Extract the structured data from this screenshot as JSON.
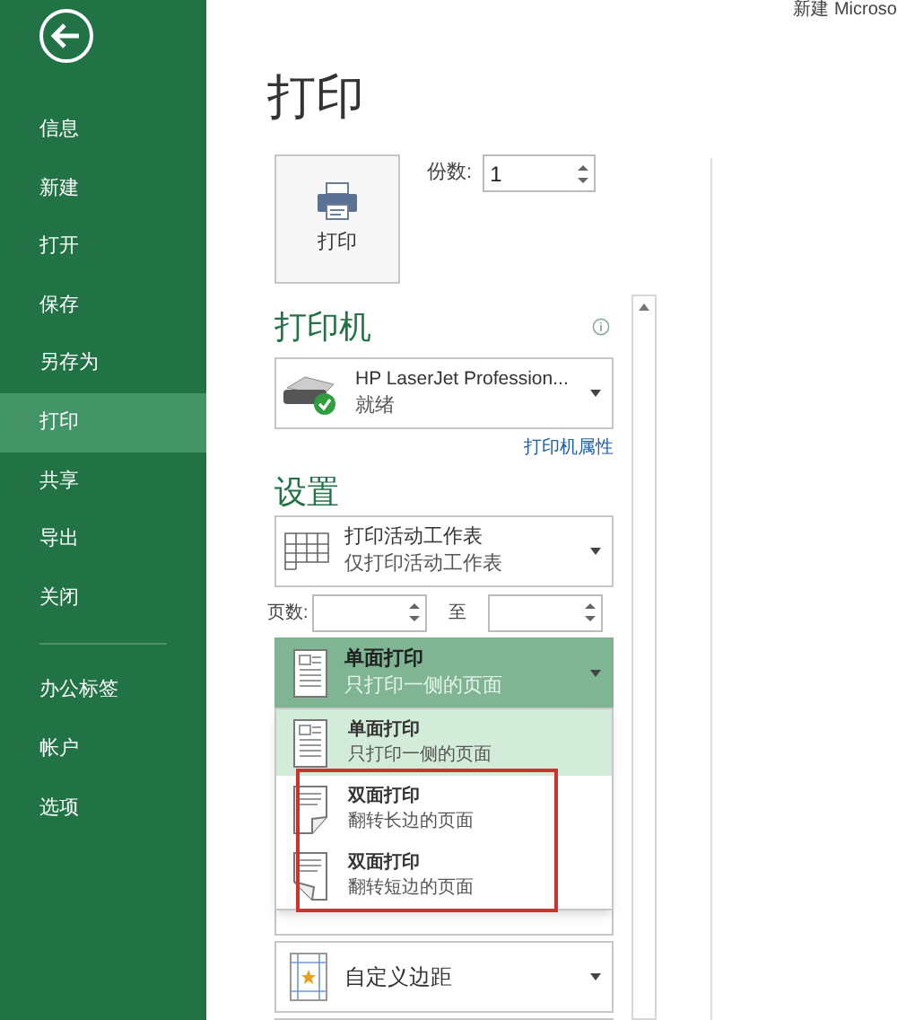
{
  "sidebar": {
    "sections": [
      {
        "items": [
          {
            "label": "信息",
            "selected": false
          },
          {
            "label": "新建",
            "selected": false
          },
          {
            "label": "打开",
            "selected": false
          },
          {
            "label": "保存",
            "selected": false
          },
          {
            "label": "另存为",
            "selected": false
          },
          {
            "label": "打印",
            "selected": true
          },
          {
            "label": "共享",
            "selected": false
          },
          {
            "label": "导出",
            "selected": false
          },
          {
            "label": "关闭",
            "selected": false
          }
        ]
      },
      {
        "items": [
          {
            "label": "办公标签",
            "selected": false
          },
          {
            "label": "帐户",
            "selected": false
          },
          {
            "label": "选项",
            "selected": false
          }
        ]
      }
    ]
  },
  "window": {
    "title": "新建 Microso"
  },
  "title": "打印",
  "print_button": {
    "label": "打印"
  },
  "copies": {
    "label": "份数:",
    "value": "1"
  },
  "printer": {
    "heading": "打印机",
    "name": "HP LaserJet Profession...",
    "status": "就绪",
    "properties_link": "打印机属性"
  },
  "settings": {
    "heading": "设置",
    "sheets": {
      "title": "打印活动工作表",
      "description": "仅打印活动工作表"
    },
    "pages": {
      "label": "页数:",
      "to": "至"
    },
    "duplex": {
      "title": "单面打印",
      "description": "只打印一侧的页面",
      "expanded": true,
      "options": [
        {
          "kind": "single",
          "title": "单面打印",
          "description": "只打印一侧的页面",
          "selected": true
        },
        {
          "kind": "long_edge",
          "title": "双面打印",
          "description": "翻转长边的页面",
          "selected": false
        },
        {
          "kind": "short_edge",
          "title": "双面打印",
          "description": "翻转短边的页面",
          "selected": false
        }
      ]
    },
    "margins": {
      "title": "自定义边距"
    }
  }
}
